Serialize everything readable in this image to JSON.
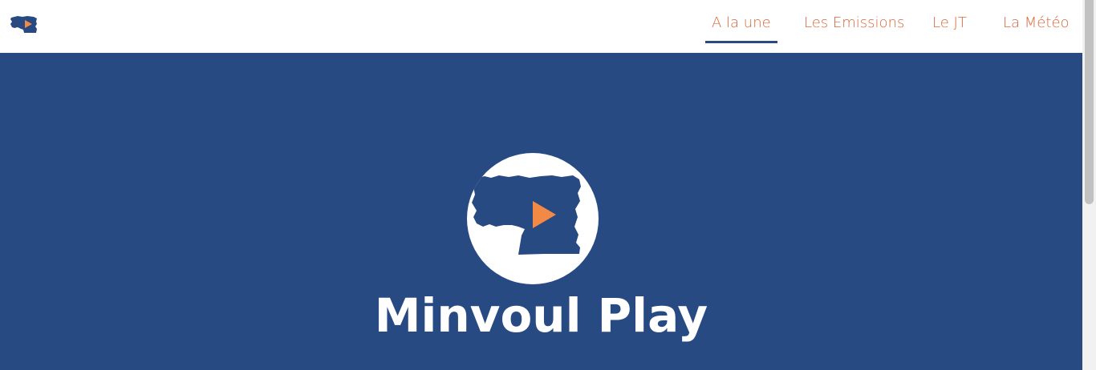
{
  "colors": {
    "brand_blue": "#284a82",
    "accent_orange": "#f28a45",
    "nav_text": "#d9663a",
    "active_underline": "#2a4a82",
    "scrollbar_track": "#f1f1f1",
    "scrollbar_thumb": "#c1c1c1"
  },
  "nav": {
    "logo_icon": "minvoul-play-logo-icon",
    "links": [
      {
        "label": "A la une",
        "active": true
      },
      {
        "label": "Les Emissions",
        "active": false
      },
      {
        "label": "Le JT",
        "active": false
      },
      {
        "label": "La Météo",
        "active": false
      }
    ]
  },
  "hero": {
    "emblem_icon": "map-play-emblem-icon",
    "title": "Minvoul Play"
  }
}
